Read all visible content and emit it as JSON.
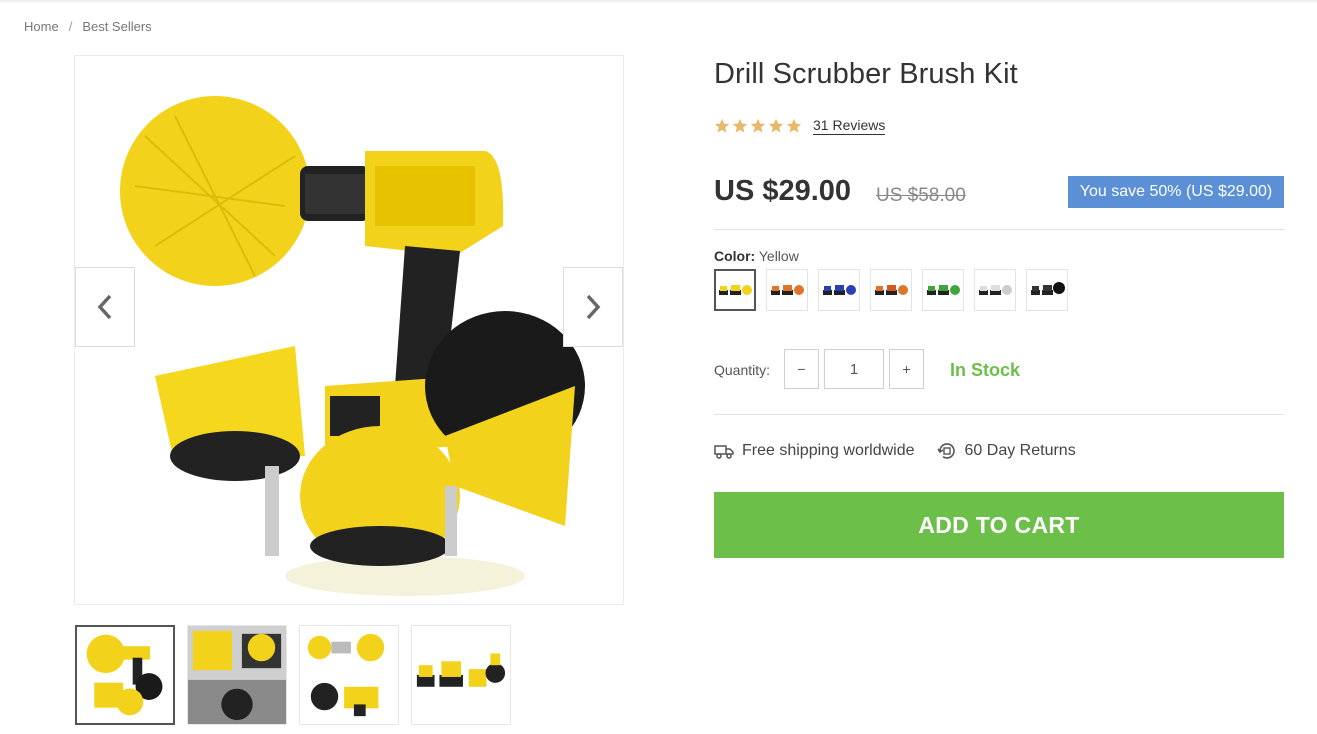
{
  "breadcrumb": {
    "home": "Home",
    "separator": "/",
    "current": "Best Sellers"
  },
  "product": {
    "title": "Drill Scrubber Brush Kit",
    "rating_stars": 5,
    "reviews_label": "31 Reviews",
    "price": "US $29.00",
    "compare_price": "US $58.00",
    "save_badge": "You save 50% (US $29.00)",
    "color_label": "Color:",
    "color_value": "Yellow",
    "color_options": [
      "Yellow",
      "Orange",
      "Blue",
      "Orange-Black",
      "Green",
      "White",
      "Black"
    ],
    "quantity_label": "Quantity:",
    "quantity_minus": "−",
    "quantity_value": "1",
    "quantity_plus": "+",
    "stock_status": "In Stock",
    "perk_shipping": "Free shipping worldwide",
    "perk_returns": "60 Day Returns",
    "add_to_cart": "ADD TO CART"
  },
  "gallery": {
    "thumbnail_count": 4,
    "active_thumbnail": 1
  },
  "colors": {
    "accent_green": "#6cc04a",
    "badge_blue": "#5b8fd6",
    "star_gold": "#e8b96a",
    "brush_yellow": "#f2d21b",
    "drill_black": "#222222"
  },
  "icons": {
    "prev": "chevron-left-icon",
    "next": "chevron-right-icon",
    "shipping": "truck-icon",
    "returns": "returns-icon",
    "star": "star-icon"
  }
}
